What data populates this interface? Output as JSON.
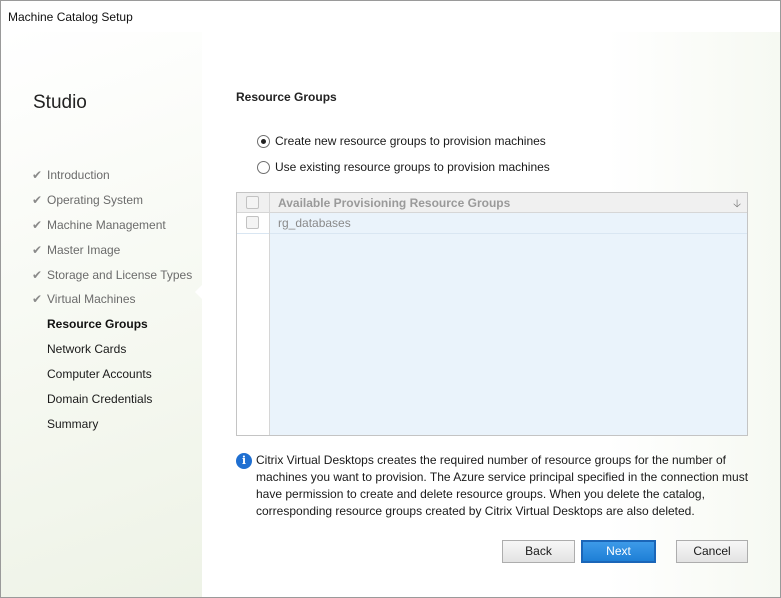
{
  "window": {
    "title": "Machine Catalog Setup"
  },
  "sidebar": {
    "brand": "Studio",
    "steps": [
      {
        "label": "Introduction",
        "state": "done"
      },
      {
        "label": "Operating System",
        "state": "done"
      },
      {
        "label": "Machine Management",
        "state": "done"
      },
      {
        "label": "Master Image",
        "state": "done"
      },
      {
        "label": "Storage and License Types",
        "state": "done"
      },
      {
        "label": "Virtual Machines",
        "state": "done"
      },
      {
        "label": "Resource Groups",
        "state": "current"
      },
      {
        "label": "Network Cards",
        "state": "pending"
      },
      {
        "label": "Computer Accounts",
        "state": "pending"
      },
      {
        "label": "Domain Credentials",
        "state": "pending"
      },
      {
        "label": "Summary",
        "state": "pending"
      }
    ],
    "check_glyph": "✔"
  },
  "main": {
    "title": "Resource Groups",
    "options": [
      {
        "label": "Create new resource groups to provision machines",
        "checked": true
      },
      {
        "label": "Use existing resource groups to provision machines",
        "checked": false
      }
    ],
    "table": {
      "column_header": "Available Provisioning Resource Groups",
      "sort_icon": "sort-down-icon",
      "rows": [
        "rg_databases"
      ]
    },
    "info": {
      "icon": "info-icon",
      "text": "Citrix Virtual Desktops creates the required number of resource groups for the number of machines you want to provision. The Azure service principal specified in the connection must have permission to create and delete resource groups. When you delete the catalog, corresponding resource groups created by Citrix Virtual Desktops are also deleted."
    }
  },
  "buttons": {
    "back": "Back",
    "next": "Next",
    "cancel": "Cancel"
  },
  "colors": {
    "primary": "#1e7fd6",
    "info": "#1f6fd1",
    "table_bg": "#eaf3fb"
  }
}
